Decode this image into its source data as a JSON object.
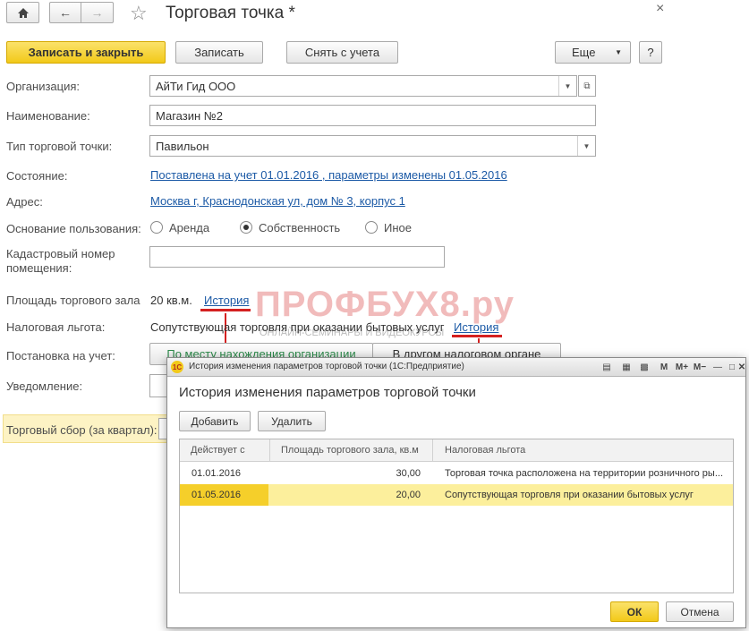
{
  "window": {
    "title": "Торговая точка *",
    "close_glyph": "×"
  },
  "toolbar": {
    "save_close_label": "Записать и закрыть",
    "save_label": "Записать",
    "deregister_label": "Снять с учета",
    "more_label": "Еще",
    "help_label": "?"
  },
  "form": {
    "org_label": "Организация:",
    "org_value": "АйТи Гид ООО",
    "name_label": "Наименование:",
    "name_value": "Магазин №2",
    "type_label": "Тип торговой точки:",
    "type_value": "Павильон",
    "state_label": "Состояние:",
    "state_value": "Поставлена на учет 01.01.2016 , параметры изменены 01.05.2016",
    "address_label": "Адрес:",
    "address_value": "Москва г, Краснодонская ул, дом № 3, корпус 1",
    "usage_label": "Основание пользования:",
    "usage_options": [
      "Аренда",
      "Собственность",
      "Иное"
    ],
    "usage_selected": "Собственность",
    "cadastral_label_1": "Кадастровый номер",
    "cadastral_label_2": "помещения:",
    "cadastral_value": "",
    "area_label": "Площадь торгового зала",
    "area_value": "20 кв.м.",
    "area_history": "История",
    "tax_label": "Налоговая льгота:",
    "tax_value": "Сопутствующая торговля при оказании бытовых услуг",
    "tax_history": "История",
    "registration_label": "Постановка на учет:",
    "registration_opt1": "По месту нахождения организации",
    "registration_opt2": "В другом налоговом органе",
    "notice_label": "Уведомление:",
    "fee_label": "Торговый сбор (за квартал):"
  },
  "watermark": {
    "main": "ПРОФБУХ8.ру",
    "sub": "ОНЛАЙН-СЕМИНАРЫ И ВИДЕОКУРСЫ"
  },
  "colors": {
    "accent_yellow": "#f5cf2a",
    "link_blue": "#1c5aa6",
    "highlight_red": "#d42020",
    "selected_row": "#fcef9c"
  },
  "modal": {
    "titlebar": "История изменения параметров торговой точки  (1С:Предприятие)",
    "titlebar_buttons": [
      "M",
      "M+",
      "M−"
    ],
    "heading": "История изменения параметров торговой точки",
    "add_label": "Добавить",
    "delete_label": "Удалить",
    "columns": [
      "Действует с",
      "Площадь торгового зала, кв.м",
      "Налоговая льгота"
    ],
    "rows": [
      {
        "date": "01.01.2016",
        "area": "30,00",
        "benefit": "Торговая точка расположена на территории розничного ры..."
      },
      {
        "date": "01.05.2016",
        "area": "20,00",
        "benefit": "Сопутствующая торговля при оказании бытовых услуг"
      }
    ],
    "ok_label": "ОК",
    "cancel_label": "Отмена"
  }
}
